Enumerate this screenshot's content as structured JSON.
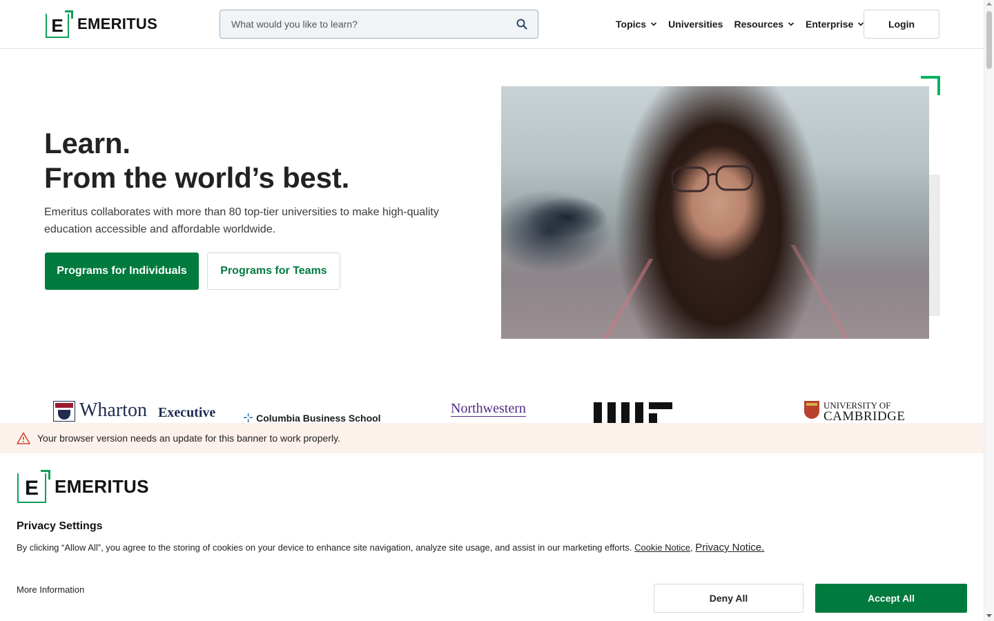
{
  "header": {
    "logo_text": "EMERITUS",
    "logo_letter": "E",
    "search": {
      "placeholder": "What would you like to learn?",
      "value": ""
    },
    "nav": [
      {
        "label": "Topics",
        "dropdown": true
      },
      {
        "label": "Universities",
        "dropdown": false
      },
      {
        "label": "Resources",
        "dropdown": true
      },
      {
        "label": "Enterprise",
        "dropdown": true
      }
    ],
    "login_label": "Login"
  },
  "hero": {
    "title_line1": "Learn.",
    "title_line2": "From the world’s best.",
    "description": "Emeritus collaborates with more than 80 top-tier universities to make high-quality education accessible and affordable worldwide.",
    "primary_button": "Programs for Individuals",
    "secondary_button": "Programs for Teams"
  },
  "university_logos": {
    "wharton_name": "Wharton",
    "wharton_sub": "Executive",
    "columbia": "Columbia Business School",
    "northwestern": "Northwestern",
    "cambridge_line1": "UNIVERSITY OF",
    "cambridge_line2": "CAMBRIDGE"
  },
  "browser_warning": {
    "text": "Your browser version needs an update for this banner to work properly."
  },
  "privacy": {
    "logo_text": "EMERITUS",
    "logo_letter": "E",
    "title": "Privacy Settings",
    "body": "By clicking “Allow All”, you agree to the storing of cookies on your device to enhance site navigation, analyze site usage, and assist in our marketing efforts.",
    "cookie_notice_link": "Cookie Notice",
    "privacy_notice_link": "Privacy Notice.",
    "more_info": "More Information",
    "deny_button": "Deny All",
    "accept_button": "Accept All"
  },
  "colors": {
    "brand_green": "#007a3d",
    "accent_green": "#0f9d58",
    "warning_bg": "#fdf1ec"
  },
  "icons": [
    "search-icon",
    "chevron-down-icon",
    "warning-icon"
  ]
}
